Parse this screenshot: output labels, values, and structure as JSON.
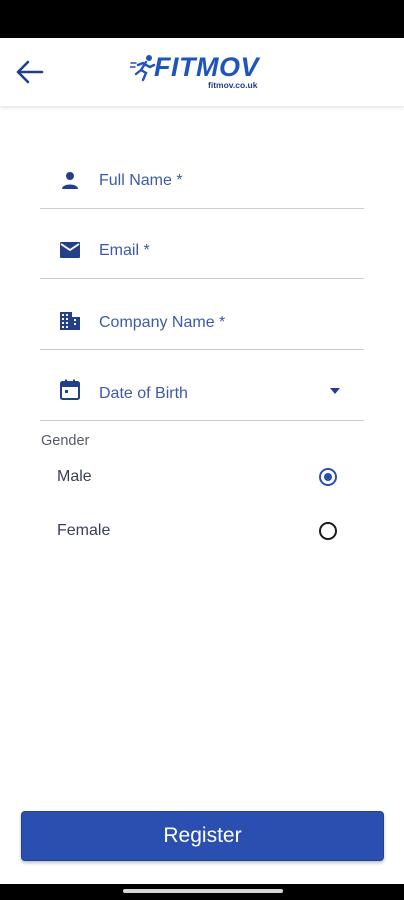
{
  "header": {
    "brand_name": "FITMOV",
    "brand_url": "fitmov.co.uk",
    "brand_color": "#1f55b8"
  },
  "form": {
    "fields": [
      {
        "icon": "person-icon",
        "label": "Full Name *"
      },
      {
        "icon": "email-icon",
        "label": "Email *"
      },
      {
        "icon": "building-icon",
        "label": "Company Name *"
      },
      {
        "icon": "calendar-icon",
        "label": "Date of Birth",
        "dropdown": true
      }
    ],
    "gender": {
      "label": "Gender",
      "options": [
        {
          "label": "Male",
          "selected": true
        },
        {
          "label": "Female",
          "selected": false
        }
      ]
    }
  },
  "footer": {
    "register_label": "Register"
  },
  "colors": {
    "primary": "#2b4fb0",
    "label_text": "#3d5aa6"
  }
}
